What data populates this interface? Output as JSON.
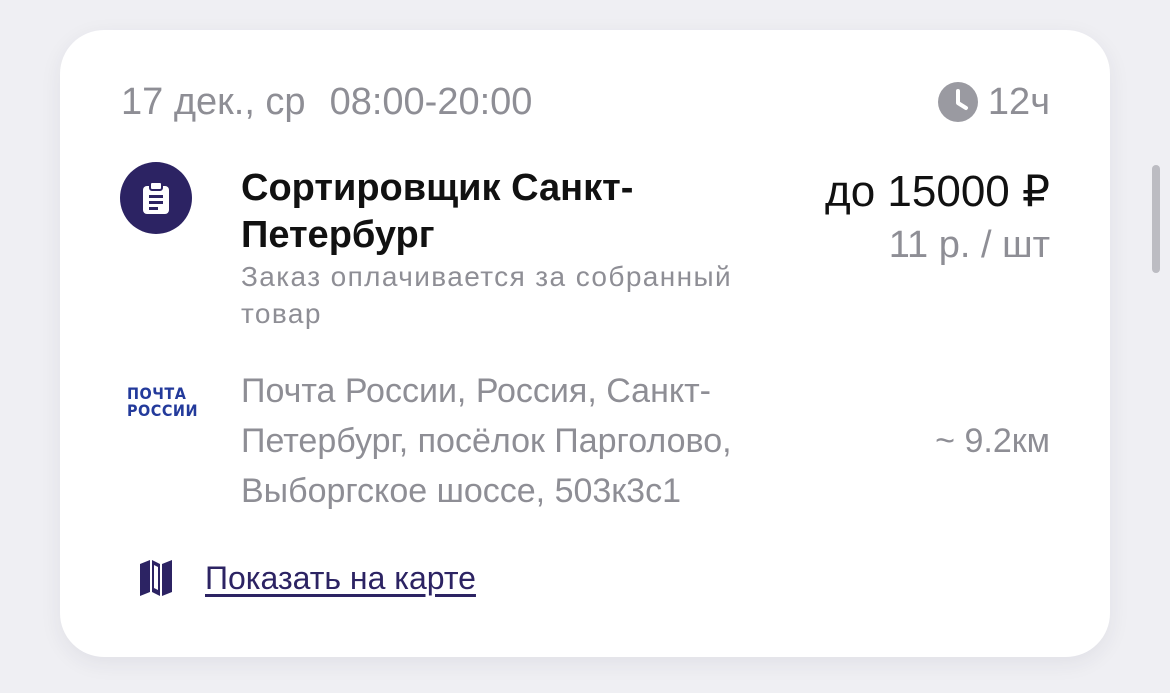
{
  "job": {
    "date": "17 дек., ср",
    "time_range": "08:00-20:00",
    "duration": "12ч",
    "title": "Сортировщик Санкт-Петербург",
    "subtitle": "Заказ оплачивается за собранный товар",
    "price": "до 15000 ₽",
    "rate": "11 р. / шт",
    "employer_logo": [
      "ПОЧТА",
      "РОССИИ"
    ],
    "address": "Почта России, Россия, Санкт-Петербург, посёлок Парголово, Выборгское шоссе, 503к3с1",
    "distance": "~ 9.2км",
    "map_link": "Показать на карте"
  },
  "icons": {
    "clock": "clock-icon",
    "task": "clipboard-icon",
    "map": "map-icon"
  },
  "colors": {
    "accent": "#2c2363",
    "muted_text": "#8e8e95",
    "logo_blue": "#233a9b",
    "page_background": "#efeff3",
    "card_background": "#ffffff"
  }
}
